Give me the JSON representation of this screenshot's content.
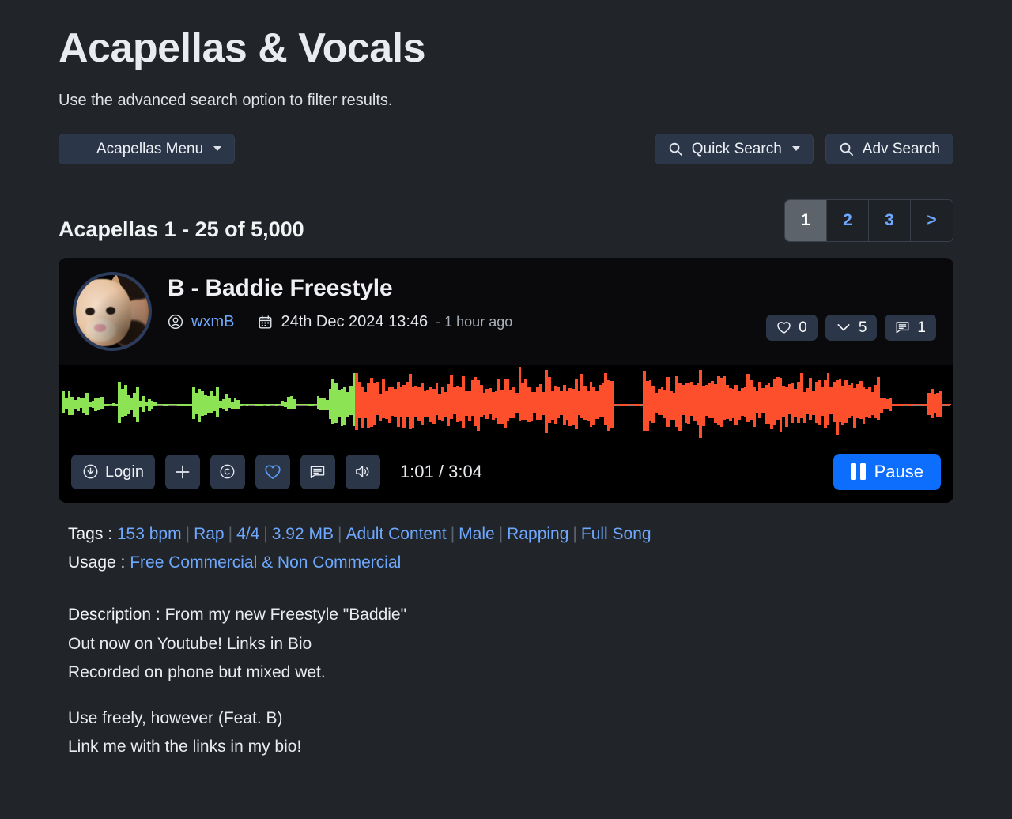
{
  "header": {
    "title": "Acapellas & Vocals",
    "subtitle": "Use the advanced search option to filter results."
  },
  "toolbar": {
    "menu_label": "Acapellas Menu",
    "menu_icon": "hamburger-icon",
    "quick_search_label": "Quick Search",
    "quick_search_icon": "search-icon",
    "adv_search_label": "Adv Search",
    "adv_search_icon": "search-icon"
  },
  "results": {
    "count_label": "Acapellas 1 - 25 of 5,000",
    "pagination": [
      {
        "label": "1",
        "active": true
      },
      {
        "label": "2",
        "active": false
      },
      {
        "label": "3",
        "active": false
      },
      {
        "label": ">",
        "active": false
      }
    ]
  },
  "track": {
    "title": "B - Baddie Freestyle",
    "user": "wxmB",
    "user_icon": "user-circle-icon",
    "date_icon": "calendar-icon",
    "date": "24th Dec 2024 13:46",
    "relative_time": "- 1 hour ago",
    "avatar_alt": "cat-and-man-avatar",
    "stats": [
      {
        "icon": "heart-icon",
        "value": "0"
      },
      {
        "icon": "download-chevron-icon",
        "value": "5"
      },
      {
        "icon": "comment-icon",
        "value": "1"
      }
    ],
    "player": {
      "login_label": "Login",
      "login_icon": "download-circle-icon",
      "add_icon": "plus-icon",
      "copyright_icon": "copyright-icon",
      "favourite_icon": "heart-icon",
      "comment_icon": "comment-icon",
      "volume_icon": "speaker-icon",
      "time_current": "1:01",
      "time_total": "3:04",
      "time_display": "1:01 / 3:04",
      "pause_label": "Pause",
      "pause_icon": "pause-icon"
    },
    "waveform": {
      "played_color": "#8ce454",
      "unplayed_color": "#fd4f2b",
      "progress_percent": 33
    },
    "tags_label": "Tags :",
    "tags": [
      "153 bpm",
      "Rap",
      "4/4",
      "3.92 MB",
      "Adult Content",
      "Male",
      "Rapping",
      "Full Song"
    ],
    "usage_label": "Usage :",
    "usage_value": "Free Commercial & Non Commercial",
    "description_label": "Description :",
    "description_lines": [
      "From my new Freestyle \"Baddie\"",
      "Out now on Youtube! Links in Bio",
      "Recorded on phone but mixed wet.",
      "",
      "Use freely, however (Feat. B)",
      "Link me with the links in my bio!"
    ]
  },
  "colors": {
    "page_bg": "#212529",
    "card_bg": "#0a0a0c",
    "accent_blue": "#0d6efd",
    "link_blue": "#6ea8fe",
    "button_bg": "#2b3648"
  }
}
